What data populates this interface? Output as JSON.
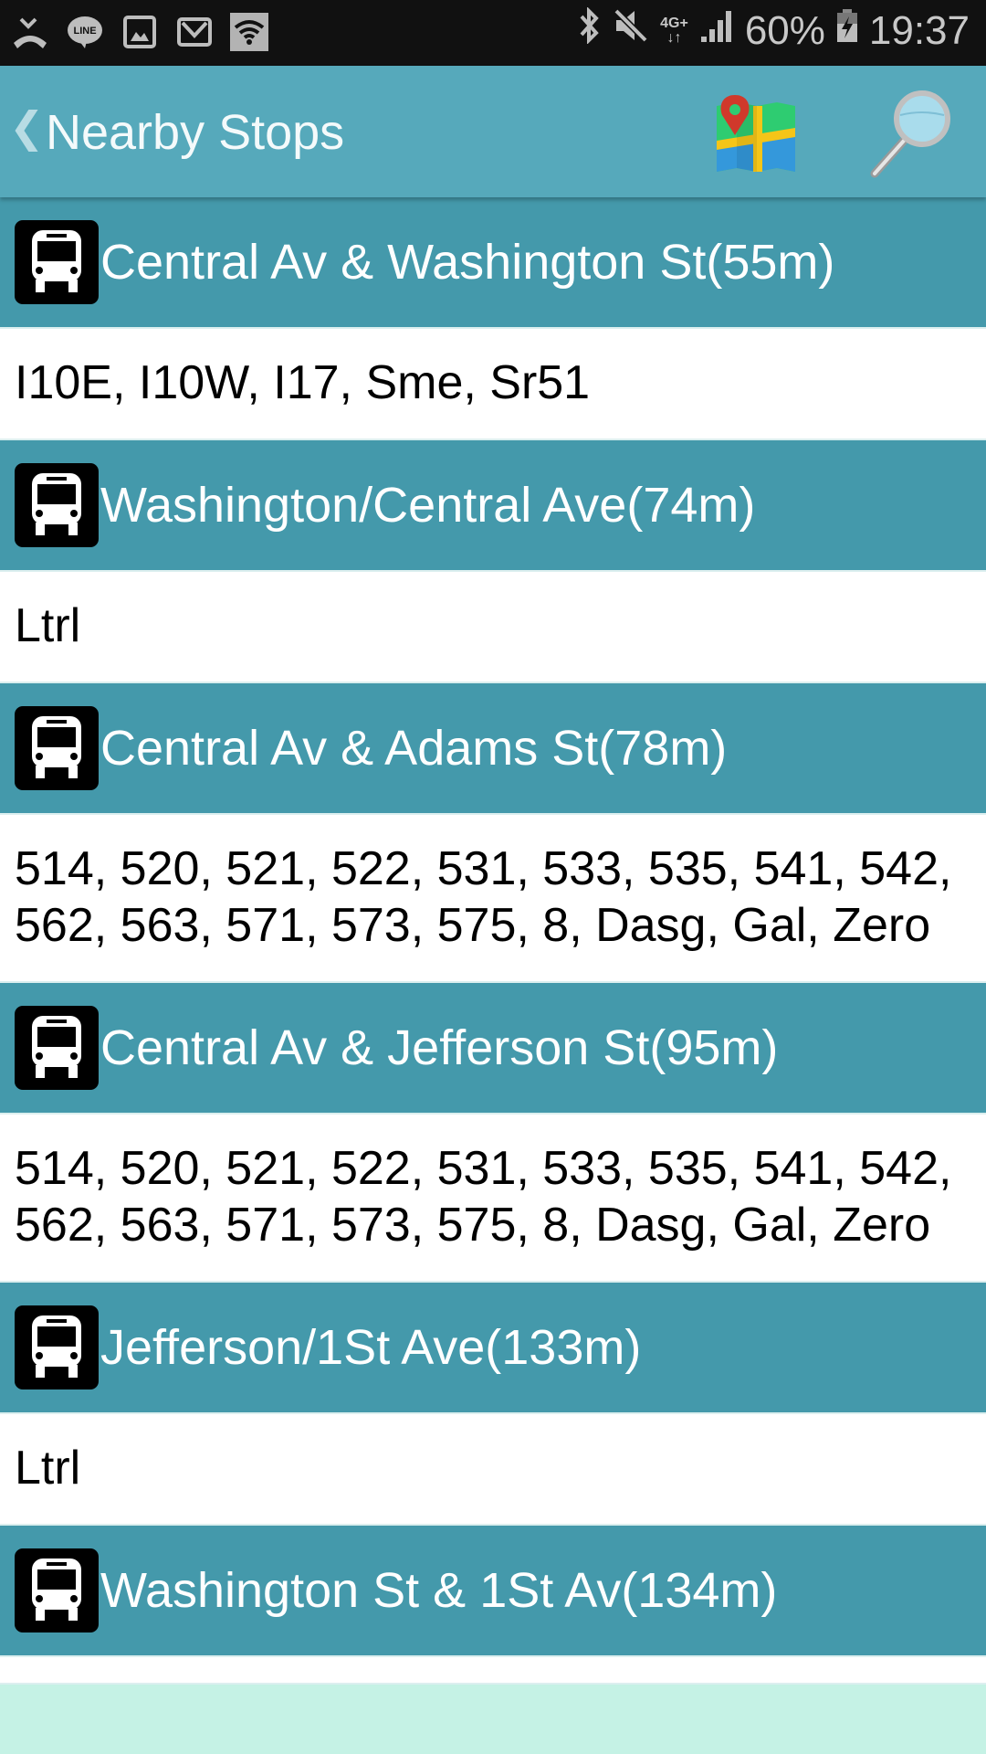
{
  "status_bar": {
    "left_icons": [
      "missed-call-icon",
      "line-app-icon",
      "gallery-icon",
      "gmail-icon",
      "wifi-icon"
    ],
    "right_icons": [
      "bluetooth-icon",
      "mute-icon",
      "4g-plus-icon",
      "signal-icon"
    ],
    "network_label": "4G+",
    "battery_percent": "60%",
    "time": "19:37"
  },
  "app_bar": {
    "back_glyph": "❮",
    "title": "Nearby Stops",
    "map_icon": "map-pin-icon",
    "search_icon": "magnifier-icon"
  },
  "colors": {
    "app_bar": "#56a9bb",
    "stop_header": "#4499ab",
    "footer": "#c5f2e5"
  },
  "stops": [
    {
      "name": "Central Av & Washington St(55m)",
      "routes": "I10E, I10W, I17, Sme, Sr51"
    },
    {
      "name": "Washington/Central Ave(74m)",
      "routes": "Ltrl"
    },
    {
      "name": "Central Av & Adams St(78m)",
      "routes": "514, 520, 521, 522, 531, 533, 535, 541, 542, 562, 563, 571, 573, 575, 8, Dasg, Gal, Zero"
    },
    {
      "name": "Central Av & Jefferson St(95m)",
      "routes": "514, 520, 521, 522, 531, 533, 535, 541, 542, 562, 563, 571, 573, 575, 8, Dasg, Gal, Zero"
    },
    {
      "name": "Jefferson/1St Ave(133m)",
      "routes": "Ltrl"
    },
    {
      "name": "Washington St & 1St Av(134m)",
      "routes": ""
    }
  ]
}
